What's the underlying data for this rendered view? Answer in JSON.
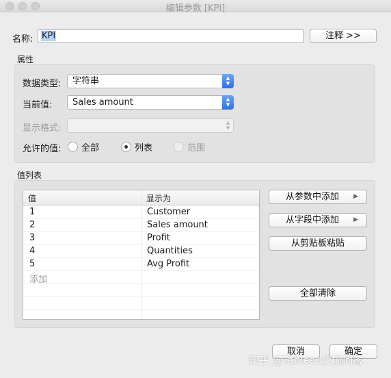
{
  "window": {
    "title": "编辑参数 [KPI]"
  },
  "name_row": {
    "label": "名称:",
    "value": "KPI",
    "comment_button": "注释 >>"
  },
  "properties": {
    "group_label": "属性",
    "data_type_label": "数据类型:",
    "data_type_value": "字符串",
    "current_value_label": "当前值:",
    "current_value_value": "Sales amount",
    "display_format_label": "显示格式:",
    "display_format_value": "",
    "allowable_label": "允许的值:",
    "allowable_options": [
      {
        "label": "全部",
        "selected": false,
        "enabled": true
      },
      {
        "label": "列表",
        "selected": true,
        "enabled": true
      },
      {
        "label": "范围",
        "selected": false,
        "enabled": false
      }
    ]
  },
  "value_list": {
    "group_label": "值列表",
    "columns": [
      "值",
      "显示为"
    ],
    "rows": [
      {
        "value": "1",
        "display": "Customer"
      },
      {
        "value": "2",
        "display": "Sales amount"
      },
      {
        "value": "3",
        "display": "Profit"
      },
      {
        "value": "4",
        "display": "Quantities"
      },
      {
        "value": "5",
        "display": "Avg Profit"
      }
    ],
    "add_hint": "添加",
    "buttons": {
      "add_from_parameter": "从参数中添加",
      "add_from_field": "从字段中添加",
      "paste": "从剪贴板粘贴",
      "clear_all": "全部清除"
    }
  },
  "footer": {
    "cancel": "取消",
    "ok": "确定"
  },
  "watermark": "知乎 @Tableau交流问答"
}
